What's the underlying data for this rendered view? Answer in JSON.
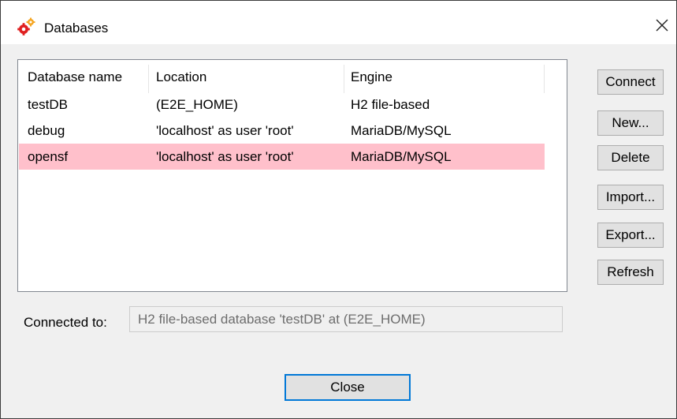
{
  "window": {
    "title": "Databases",
    "icon": "database-gears-icon"
  },
  "table": {
    "columns": [
      "Database name",
      "Location",
      "Engine"
    ],
    "rows": [
      {
        "name": "testDB",
        "location": "(E2E_HOME)",
        "engine": "H2 file-based",
        "selected": false
      },
      {
        "name": "debug",
        "location": "'localhost' as user 'root'",
        "engine": "MariaDB/MySQL",
        "selected": false
      },
      {
        "name": "opensf",
        "location": "'localhost' as user 'root'",
        "engine": "MariaDB/MySQL",
        "selected": true
      }
    ],
    "selected_row_color": "#ffc0cb"
  },
  "buttons": {
    "connect": "Connect",
    "new": "New...",
    "delete": "Delete",
    "import": "Import...",
    "export": "Export...",
    "refresh": "Refresh"
  },
  "connection": {
    "label": "Connected to:",
    "value": "H2 file-based database 'testDB' at (E2E_HOME)"
  },
  "footer": {
    "close_label": "Close"
  }
}
